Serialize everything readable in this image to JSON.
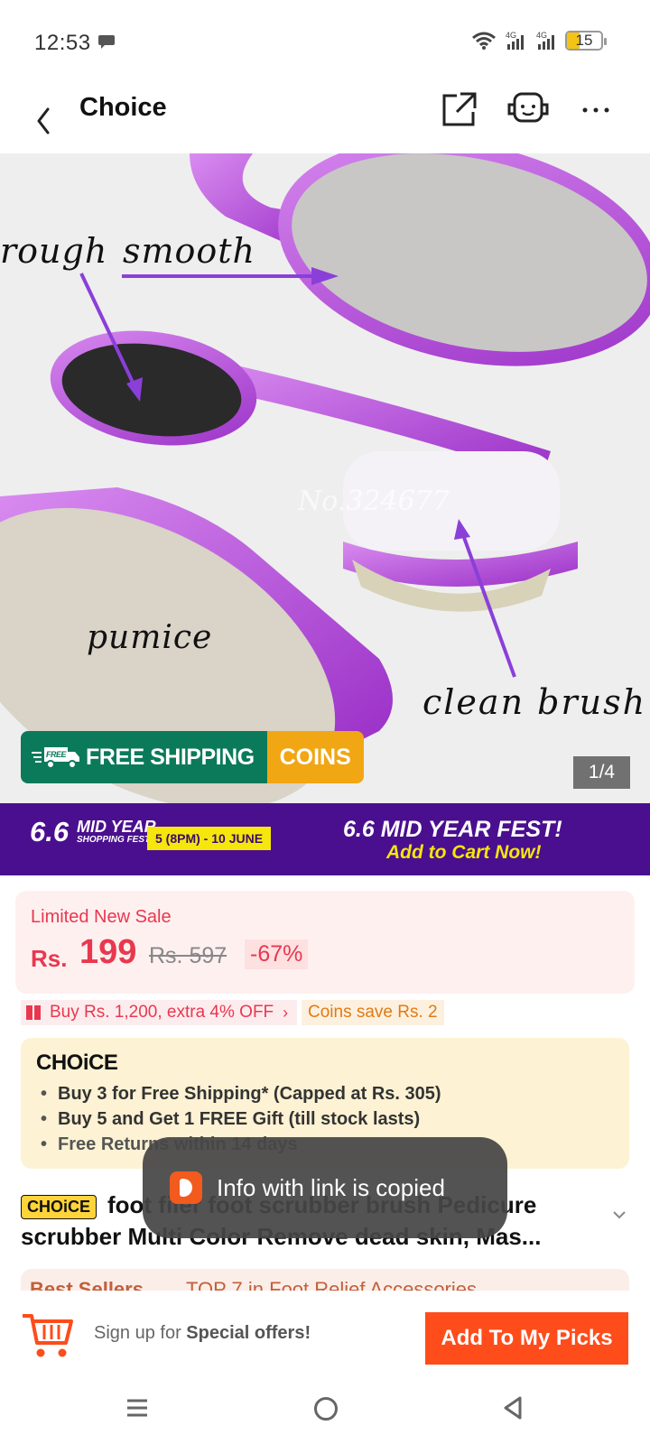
{
  "status_bar": {
    "time": "12:53",
    "network_1": "4G",
    "network_2": "4G",
    "battery": "15"
  },
  "header": {
    "title": "Choice"
  },
  "hero": {
    "labels": {
      "rough": "rough",
      "smooth": "smooth",
      "pumice": "pumice",
      "clean_brush": "clean brush"
    },
    "watermark": "No.324677",
    "free_shipping_badge": "FREE",
    "free_shipping": "FREE SHIPPING",
    "coins": "COINS",
    "image_counter": "1/4"
  },
  "promo": {
    "left_big": "6.6",
    "left_mid": "MID YEAR",
    "left_small": "SHOPPING FEST!",
    "date": "5 (8PM) - 10 JUNE",
    "right_title": "6.6 MID YEAR FEST!",
    "right_cta": "Add to Cart Now!"
  },
  "price": {
    "label": "Limited New Sale",
    "currency": "Rs.",
    "current": "199",
    "original": "Rs. 597",
    "discount": "-67%"
  },
  "chips": {
    "buy_offer": "Buy Rs. 1,200, extra 4% OFF",
    "coins_save": "Coins save Rs. 2"
  },
  "choice": {
    "logo": "CHOiCE",
    "benefits": [
      "Buy 3 for  Free Shipping* (Capped at Rs. 305)",
      "Buy 5 and Get 1 FREE Gift (till stock lasts)",
      "Free Returns within 14 days"
    ]
  },
  "product": {
    "badge": "CHOiCE",
    "title": "foot filer foot scrubber brush Pedicure scrubber Multi Color Remove dead skin, Mas..."
  },
  "best_sellers": {
    "label": "Best Sellers",
    "rank": "TOP 7 in Foot Relief Accessories"
  },
  "toast": {
    "text": "Info with link is copied"
  },
  "bottom_bar": {
    "signup_prefix": "Sign up for ",
    "signup_bold": "Special offers!",
    "picks_button": "Add To My Picks"
  },
  "colors": {
    "accent_orange": "#fe4c1b",
    "price_red": "#e8384f",
    "promo_purple": "#4a0f8e",
    "shipping_green": "#0b7a5a",
    "coins_orange": "#f1a614"
  }
}
